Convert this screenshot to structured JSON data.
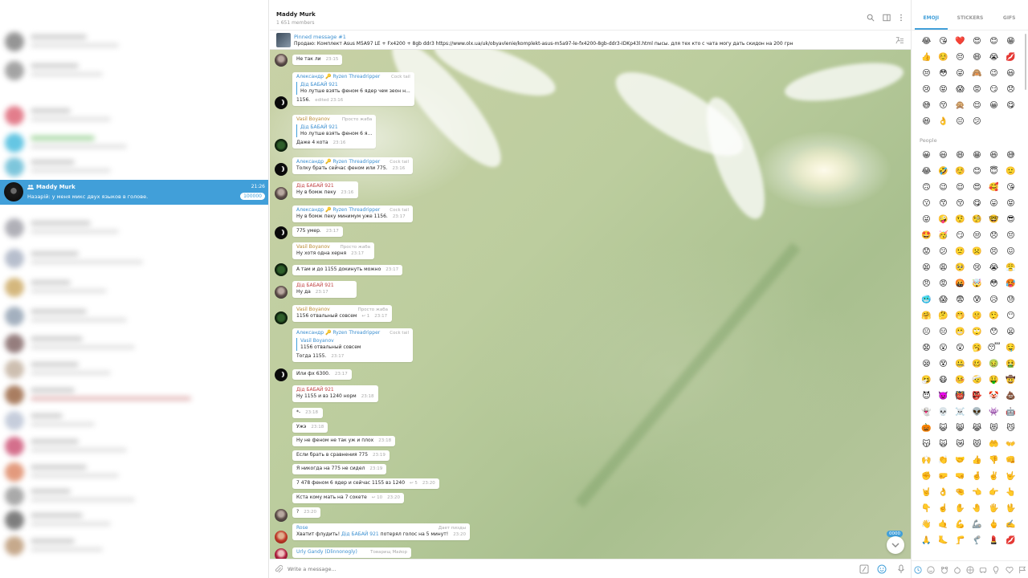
{
  "sidebar": {
    "active_chat": {
      "name": "Maddy Murk",
      "time": "21:26",
      "preview": "Назарій: у меня микс двух языков в голове.",
      "unread": "100000"
    }
  },
  "header": {
    "title": "Maddy Murk",
    "subtitle": "1 651 members"
  },
  "pinned": {
    "title": "Pinned message #1",
    "text": "Продаю: Комплект Asus M5A97 LE + Fx4200 + 8gb ddr3 https://www.olx.ua/uk/obyavlenie/komplekt-asus-m5a97-le-fx4200-8gb-ddr3-IDKp43l.html пысы. для тех кто с чата могу дать скидон на 200 грн"
  },
  "messages": [
    {
      "sender": "",
      "role": "",
      "text": "Не так ли",
      "time": "23:15",
      "quote_name": "",
      "quote_text": "",
      "replies": ""
    },
    {
      "sender": "Александр 🔑 Ryzen Threadripper",
      "role": "Cock tail",
      "text": "1156.",
      "time": "edited 23:16",
      "quote_name": "Дід БАБАЙ 921",
      "quote_text": "Но лутше взять феном 6 ядер чем зеон н...",
      "replies": ""
    },
    {
      "sender": "Vasil Boyanov",
      "role": "Просто жаба",
      "text": "Даже 4 кота",
      "time": "23:16",
      "quote_name": "Дід БАБАЙ 921",
      "quote_text": "Но лутше взять феном 6 я...",
      "replies": ""
    },
    {
      "sender": "Александр 🔑 Ryzen Threadripper",
      "role": "Cock tail",
      "text": "Толку брать сейчас феном или 775.",
      "time": "23:16",
      "quote_name": "",
      "quote_text": "",
      "replies": ""
    },
    {
      "sender": "Дід БАБАЙ 921",
      "role": "",
      "text": "Ну в бомж пеку",
      "time": "23:16",
      "quote_name": "",
      "quote_text": "",
      "replies": ""
    },
    {
      "sender": "Александр 🔑 Ryzen Threadripper",
      "role": "Cock tail",
      "text": "Ну в бомж пеку минимум уже 1156.",
      "time": "23:17",
      "quote_name": "",
      "quote_text": "",
      "replies": ""
    },
    {
      "sender": "",
      "role": "",
      "text": "775 умер.",
      "time": "23:17",
      "quote_name": "",
      "quote_text": "",
      "replies": ""
    },
    {
      "sender": "Vasil Boyanov",
      "role": "Просто жаба",
      "text": "Ну хотя одна херня",
      "time": "23:17",
      "quote_name": "",
      "quote_text": "",
      "replies": ""
    },
    {
      "sender": "",
      "role": "",
      "text": "А там и до 1155 докинуть можно",
      "time": "23:17",
      "quote_name": "",
      "quote_text": "",
      "replies": ""
    },
    {
      "sender": "Дід БАБАЙ 921",
      "role": "",
      "text": "Ну да",
      "time": "23:17",
      "quote_name": "",
      "quote_text": "",
      "replies": ""
    },
    {
      "sender": "Vasil Boyanov",
      "role": "Просто жаба",
      "text": "1156 отвальный совсем",
      "time": "23:17",
      "quote_name": "",
      "quote_text": "",
      "replies": "1"
    },
    {
      "sender": "Александр 🔑 Ryzen Threadripper",
      "role": "Cock tail",
      "text": "Тогда 1155.",
      "time": "23:17",
      "quote_name": "Vasil Boyanov",
      "quote_text": "1156 отвальный совсем",
      "replies": ""
    },
    {
      "sender": "",
      "role": "",
      "text": "Или фх 6300.",
      "time": "23:17",
      "quote_name": "",
      "quote_text": "",
      "replies": ""
    },
    {
      "sender": "Дід БАБАЙ 921",
      "role": "",
      "text": "Ну 1155 и вз 1240 норм",
      "time": "23:18",
      "quote_name": "",
      "quote_text": "",
      "replies": ""
    },
    {
      "sender": "",
      "role": "",
      "text": "*-",
      "time": "23:18",
      "quote_name": "",
      "quote_text": "",
      "replies": ""
    },
    {
      "sender": "",
      "role": "",
      "text": "Ужэ",
      "time": "23:18",
      "quote_name": "",
      "quote_text": "",
      "replies": ""
    },
    {
      "sender": "",
      "role": "",
      "text": "Ну не феном не так уж и плох",
      "time": "23:18",
      "quote_name": "",
      "quote_text": "",
      "replies": ""
    },
    {
      "sender": "",
      "role": "",
      "text": "Если брать в сравнения 775",
      "time": "23:19",
      "quote_name": "",
      "quote_text": "",
      "replies": ""
    },
    {
      "sender": "",
      "role": "",
      "text": "Я никогда на 775 не сидел",
      "time": "23:19",
      "quote_name": "",
      "quote_text": "",
      "replies": ""
    },
    {
      "sender": "",
      "role": "",
      "text": "7 478 феном 6 ядер и сейчас 1155 вз 1240",
      "time": "23:20",
      "quote_name": "",
      "quote_text": "",
      "replies": "5"
    },
    {
      "sender": "",
      "role": "",
      "text": "Кста кому мать на 7 сокете",
      "time": "23:20",
      "quote_name": "",
      "quote_text": "",
      "replies": "10"
    },
    {
      "sender": "",
      "role": "",
      "text": "?",
      "time": "23:20",
      "quote_name": "",
      "quote_text": "",
      "replies": ""
    },
    {
      "sender": "Rose",
      "role": "Дает пизды",
      "text": "Хватит флудить!",
      "mention": "Дід БАБАЙ 921",
      "text2": "потерял голос на 5 минут!",
      "time": "23:20",
      "quote_name": "",
      "quote_text": "",
      "replies": ""
    },
    {
      "sender": "Urly Gandy (Dlinnonogly)",
      "role": "Товарищ Майор",
      "text": "",
      "time": "",
      "quote_name": "",
      "quote_text": "",
      "replies": ""
    }
  ],
  "scroll_badge": "0000",
  "composer": {
    "placeholder": "Write a message..."
  },
  "emoji_panel": {
    "tabs": [
      "EMOJI",
      "STICKERS",
      "GIFS"
    ],
    "recent": [
      "😂",
      "😘",
      "❤️",
      "😍",
      "😊",
      "😁",
      "👍",
      "☺️",
      "😔",
      "😄",
      "😭",
      "💋",
      "😒",
      "😳",
      "😜",
      "🙈",
      "😉",
      "😃",
      "😢",
      "😝",
      "😱",
      "😡",
      "😏",
      "😞",
      "😅",
      "😚",
      "🙊",
      "😌",
      "😀",
      "😋",
      "😆",
      "👌",
      "😐",
      "😕"
    ],
    "people_label": "People",
    "people": [
      "😀",
      "😃",
      "😄",
      "😁",
      "😆",
      "😅",
      "😂",
      "🤣",
      "☺️",
      "😊",
      "😇",
      "🙂",
      "🙃",
      "😉",
      "😌",
      "😍",
      "🥰",
      "😘",
      "😗",
      "😙",
      "😚",
      "😋",
      "😛",
      "😝",
      "😜",
      "🤪",
      "🤨",
      "🧐",
      "🤓",
      "😎",
      "🤩",
      "🥳",
      "😏",
      "😒",
      "😞",
      "😔",
      "😟",
      "😕",
      "🙁",
      "☹️",
      "😣",
      "😖",
      "😫",
      "😩",
      "🥺",
      "😢",
      "😭",
      "😤",
      "😠",
      "😡",
      "🤬",
      "🤯",
      "😳",
      "🥵",
      "🥶",
      "😱",
      "😨",
      "😰",
      "😥",
      "😓",
      "🤗",
      "🤔",
      "🤭",
      "🤫",
      "🤥",
      "😶",
      "😐",
      "😑",
      "😬",
      "🙄",
      "😯",
      "😦",
      "😧",
      "😮",
      "😲",
      "🥱",
      "😴",
      "🤤",
      "😪",
      "😵",
      "🤐",
      "🥴",
      "🤢",
      "🤮",
      "🤧",
      "😷",
      "🤒",
      "🤕",
      "🤑",
      "🤠",
      "😈",
      "👿",
      "👹",
      "👺",
      "🤡",
      "💩",
      "👻",
      "💀",
      "☠️",
      "👽",
      "👾",
      "🤖",
      "🎃",
      "😺",
      "😸",
      "😹",
      "😻",
      "😼",
      "😽",
      "🙀",
      "😿",
      "😾",
      "🤲",
      "👐",
      "🙌",
      "👏",
      "🤝",
      "👍",
      "👎",
      "👊",
      "✊",
      "🤛",
      "🤜",
      "🤞",
      "✌️",
      "🤟",
      "🤘",
      "👌",
      "🤏",
      "👈",
      "👉",
      "👆",
      "👇",
      "☝️",
      "✋",
      "🤚",
      "🖐️",
      "🖖",
      "👋",
      "🤙",
      "💪",
      "🦾",
      "🖕",
      "✍️",
      "🙏",
      "🦶",
      "🦵",
      "🦿",
      "💄",
      "💋",
      "👄",
      "🦷",
      "👅",
      "👂"
    ]
  }
}
